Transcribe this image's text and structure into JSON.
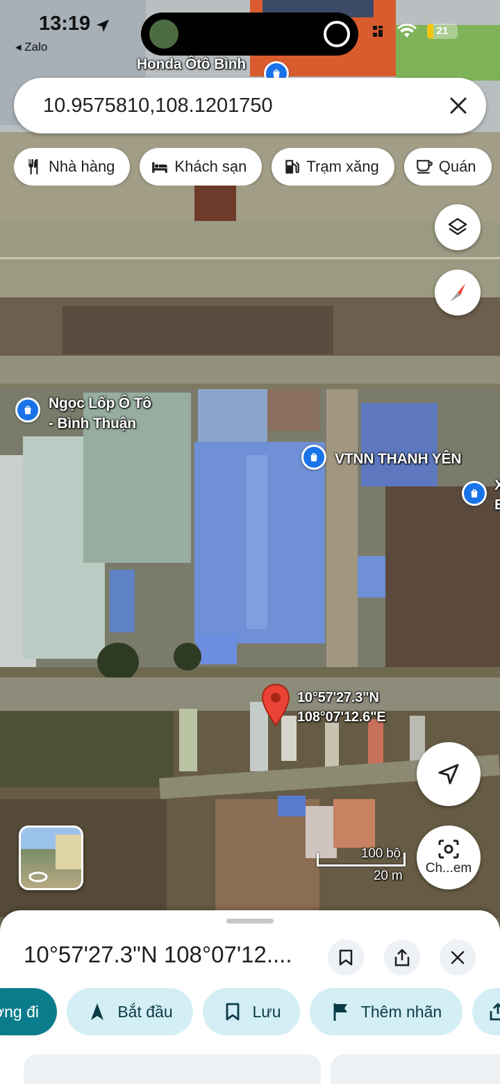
{
  "status_bar": {
    "time": "13:19",
    "back_label": "◂ Zalo",
    "battery": "21"
  },
  "search": {
    "query": "10.9575810,108.1201750"
  },
  "chips": [
    {
      "icon": "restaurant-icon",
      "label": "Nhà hàng"
    },
    {
      "icon": "hotel-icon",
      "label": "Khách sạn"
    },
    {
      "icon": "gas-station-icon",
      "label": "Trạm xăng"
    },
    {
      "icon": "cafe-icon",
      "label": "Quán"
    }
  ],
  "map": {
    "labels": {
      "honda": "Honda Ôtô Bình",
      "ngoc_lop_1": "Ngọc Lốp Ô Tô",
      "ngoc_lop_2": "- Bình Thuận",
      "vtnn": "VTNN THANH YÊN",
      "edge_1": "X",
      "edge_2": "E"
    },
    "pin_lat": "10°57'27.3\"N",
    "pin_lng": "108°07'12.6\"E",
    "scale_top": "100 bộ",
    "scale_bottom": "20 m",
    "lens_label": "Ch...em"
  },
  "place": {
    "title": "10°57'27.3\"N 108°07'12...."
  },
  "actions": [
    {
      "label": "ường đi"
    },
    {
      "label": "Bắt đầu"
    },
    {
      "label": "Lưu"
    },
    {
      "label": "Thêm nhãn"
    }
  ],
  "colors": {
    "accent": "#0b7c8c",
    "chip_bg": "#d3eef5",
    "pin": "#ea4335",
    "shop_pin": "#1a73e8"
  }
}
